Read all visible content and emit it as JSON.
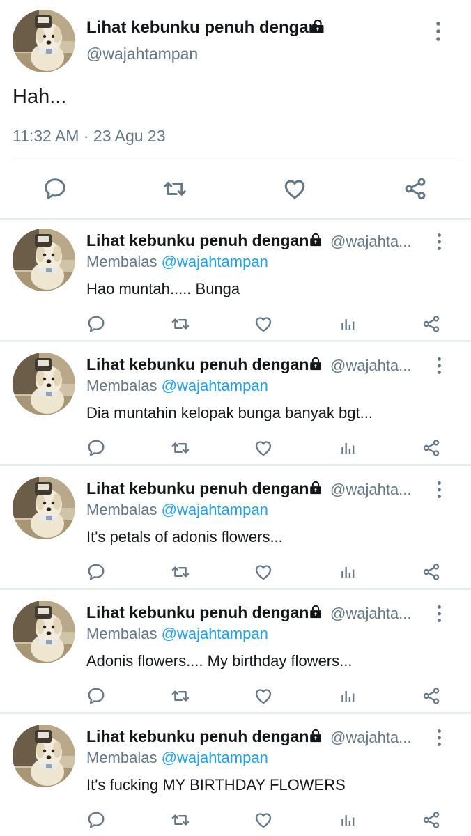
{
  "main_tweet": {
    "display_name": "Lihat kebunku penuh dengan",
    "handle": "@wajahtampan",
    "text": "Hah...",
    "timestamp": "11:32 AM · 23 Agu 23",
    "icons": {
      "lock": "lock-icon",
      "more": "more-options-icon",
      "reply": "reply-icon",
      "retweet": "retweet-icon",
      "like": "like-icon",
      "share": "share-icon"
    }
  },
  "replies": [
    {
      "display_name": "Lihat kebunku penuh dengan",
      "handle": "@wajahta...",
      "replying_prefix": "Membalas",
      "replying_mention": "@wajahtampan",
      "text": "Hao muntah..... Bunga"
    },
    {
      "display_name": "Lihat kebunku penuh dengan",
      "handle": "@wajahta...",
      "replying_prefix": "Membalas",
      "replying_mention": "@wajahtampan",
      "text": "Dia muntahin kelopak bunga banyak bgt..."
    },
    {
      "display_name": "Lihat kebunku penuh dengan",
      "handle": "@wajahta...",
      "replying_prefix": "Membalas",
      "replying_mention": "@wajahtampan",
      "text": "It's petals of adonis flowers..."
    },
    {
      "display_name": "Lihat kebunku penuh dengan",
      "handle": "@wajahta...",
      "replying_prefix": "Membalas",
      "replying_mention": "@wajahtampan",
      "text": "Adonis flowers.... My birthday flowers..."
    },
    {
      "display_name": "Lihat kebunku penuh dengan",
      "handle": "@wajahta...",
      "replying_prefix": "Membalas",
      "replying_mention": "@wajahtampan",
      "text": "It's fucking MY BIRTHDAY FLOWERS"
    }
  ],
  "colors": {
    "text": "#14171a",
    "secondary": "#657786",
    "mention": "#1da1f2",
    "divider": "#e6ecf0"
  }
}
